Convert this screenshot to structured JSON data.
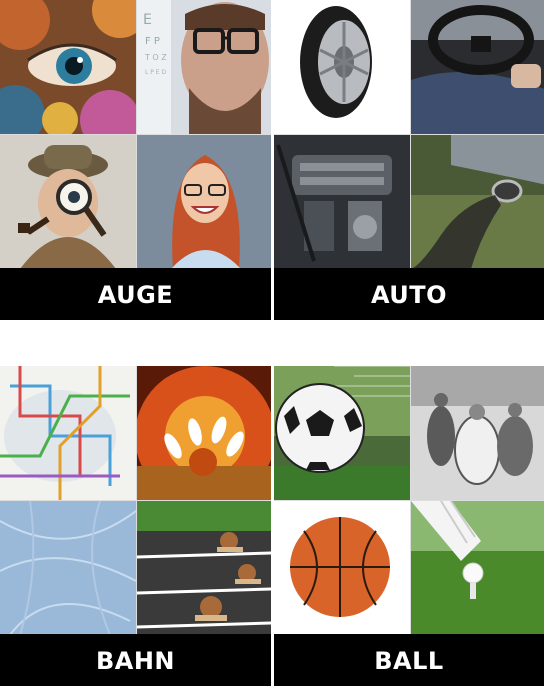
{
  "cards": [
    {
      "label": "AUGE",
      "images": [
        "painted-eye-image",
        "eye-test-man-image",
        "detective-magnifier-image",
        "redhead-glasses-woman-image"
      ]
    },
    {
      "label": "AUTO",
      "images": [
        "tire-image",
        "driver-steering-wheel-image",
        "car-engine-image",
        "exhaust-smoke-image"
      ]
    },
    {
      "label": "BAHN",
      "images": [
        "transit-map-image",
        "bowling-strike-image",
        "ice-rink-image",
        "snail-race-track-image"
      ]
    },
    {
      "label": "BALL",
      "images": [
        "soccer-ball-net-image",
        "historic-ball-dance-image",
        "basketball-image",
        "golf-ball-tee-image"
      ]
    }
  ]
}
